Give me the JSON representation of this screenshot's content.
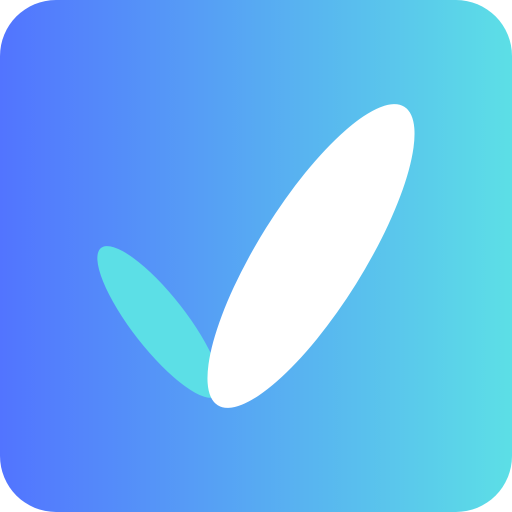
{
  "icon": {
    "name": "checkmark-app-icon",
    "colors": {
      "gradient_start": "#5274FF",
      "gradient_end": "#5CDFE6",
      "left_leaf": "#5CDFE6",
      "right_leaf": "#FFFFFF"
    }
  }
}
